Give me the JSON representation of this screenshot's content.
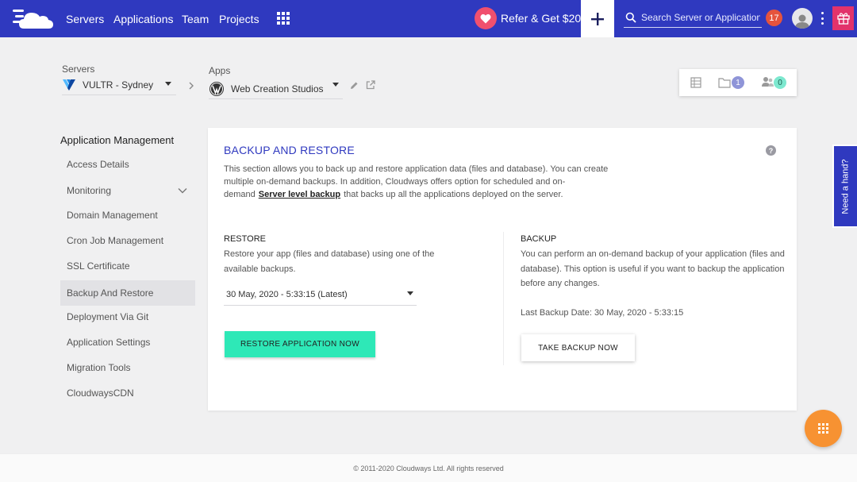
{
  "nav": {
    "links": [
      "Servers",
      "Applications",
      "Team",
      "Projects"
    ],
    "refer_label": "Refer & Get $20",
    "search_placeholder": "Search Server or Application",
    "notification_count": "17"
  },
  "breadcrumb": {
    "servers_label": "Servers",
    "server_name": "VULTR - Sydney",
    "apps_label": "Apps",
    "app_name": "Web Creation Studios"
  },
  "stats": {
    "folders_count": "1",
    "members_count": "0"
  },
  "sidebar": {
    "title": "Application Management",
    "items": [
      {
        "label": "Access Details"
      },
      {
        "label": "Monitoring"
      },
      {
        "label": "Domain Management"
      },
      {
        "label": "Cron Job Management"
      },
      {
        "label": "SSL Certificate"
      },
      {
        "label": "Backup And Restore"
      },
      {
        "label": "Deployment Via Git"
      },
      {
        "label": "Application Settings"
      },
      {
        "label": "Migration Tools"
      },
      {
        "label": "CloudwaysCDN"
      }
    ]
  },
  "main": {
    "title": "BACKUP AND RESTORE",
    "description_pre": "This section allows you to back up and restore application data (files and database). You can create multiple on-demand backups. In addition, Cloudways offers option for scheduled and on-demand",
    "description_link": "Server level backup",
    "description_post": "that backs up all the applications deployed on the server.",
    "restore": {
      "title": "RESTORE",
      "text": "Restore your app (files and database) using one of the available backups.",
      "selected_backup": "30 May, 2020 - 5:33:15 (Latest)",
      "button": "RESTORE APPLICATION NOW"
    },
    "backup": {
      "title": "BACKUP",
      "text": "You can perform an on-demand backup of your application (files and database). This option is useful if you want to backup the application before any changes.",
      "last_backup": "Last Backup Date: 30 May, 2020 - 5:33:15",
      "button": "TAKE BACKUP NOW"
    }
  },
  "need_hand": "Need a hand?",
  "footer": "© 2011-2020 Cloudways Ltd. All rights reserved",
  "colors": {
    "brand": "#2f39bf",
    "accent_green": "#2ee8b7",
    "fab_orange": "#f79232",
    "notification_red": "#e5533d",
    "gift_pink": "#e2336b"
  }
}
